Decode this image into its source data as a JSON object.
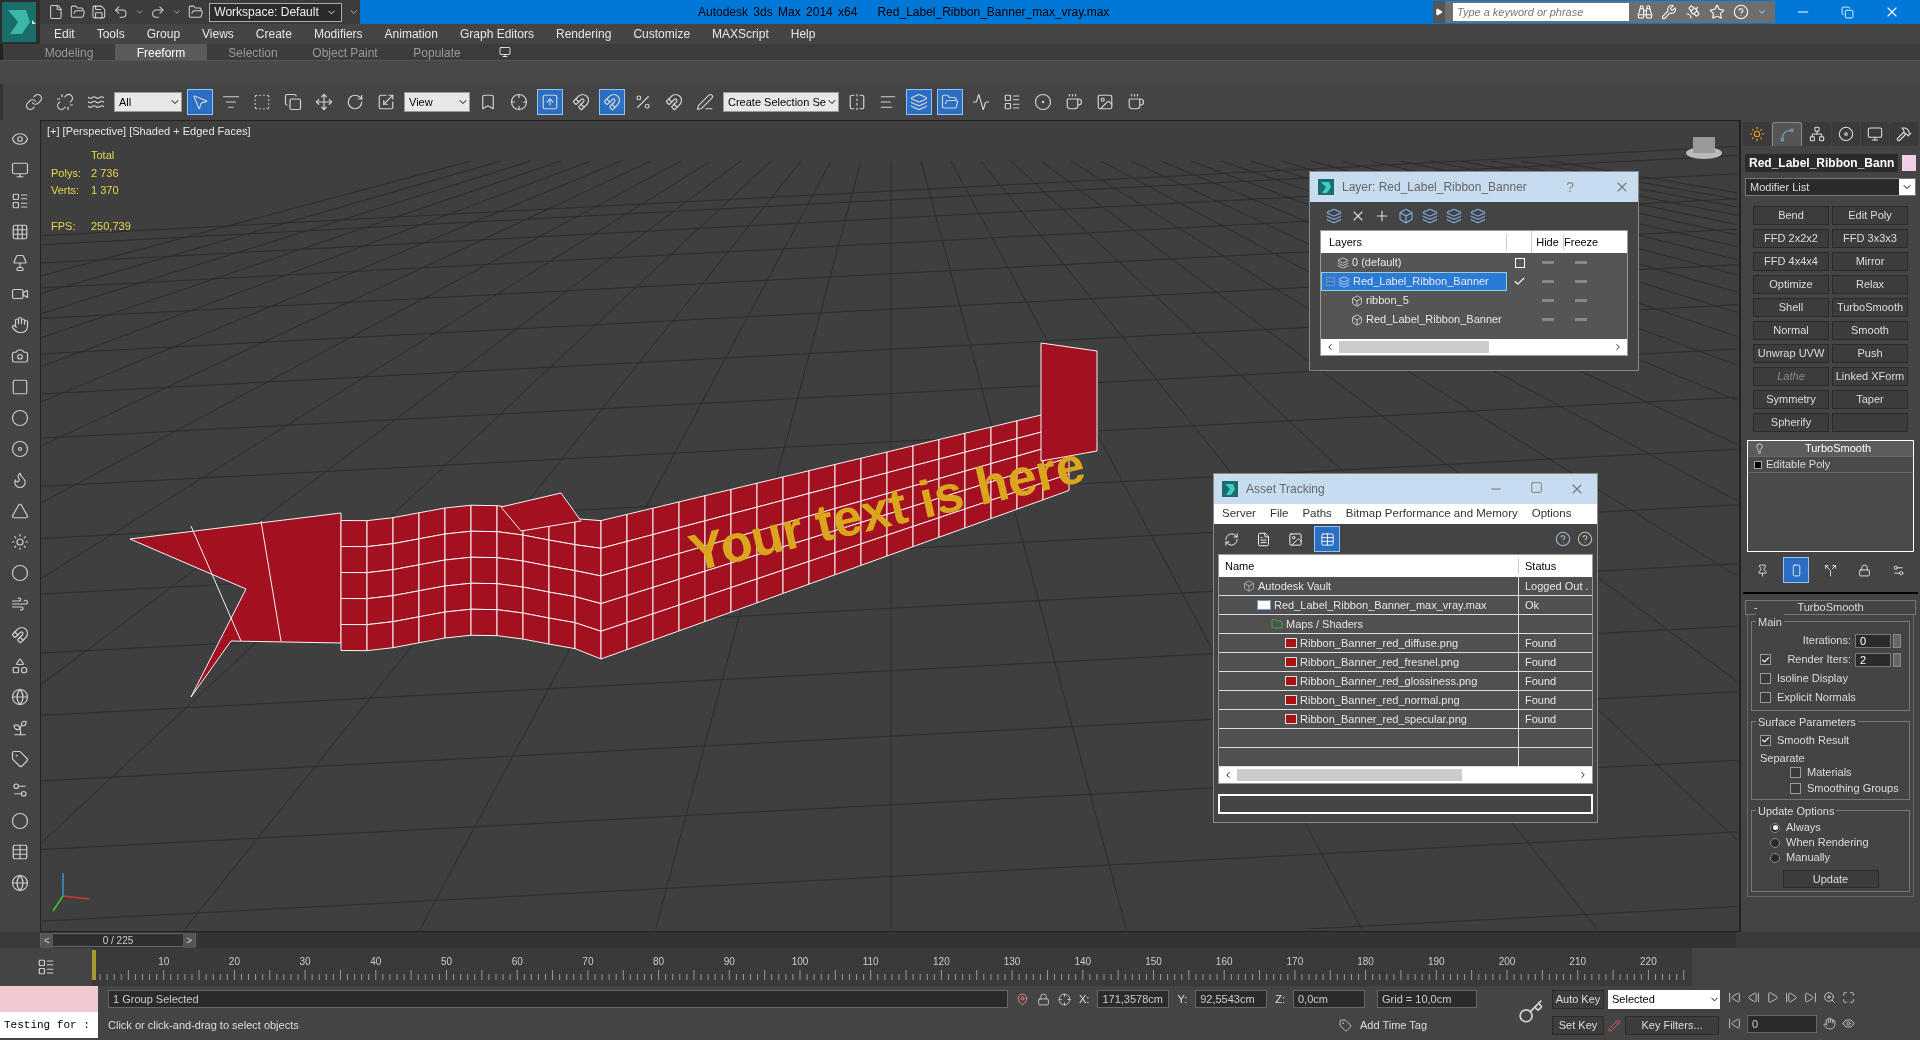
{
  "title_bar": {
    "workspace": "Workspace: Default",
    "app_title": "Autodesk 3ds Max  2014 x64",
    "file_name": "Red_Label_Ribbon_Banner_max_vray.max",
    "search_placeholder": "Type a keyword or phrase"
  },
  "menu_bar": [
    "Edit",
    "Tools",
    "Group",
    "Views",
    "Create",
    "Modifiers",
    "Animation",
    "Graph Editors",
    "Rendering",
    "Customize",
    "MAXScript",
    "Help"
  ],
  "ribbon_tabs": [
    {
      "label": "Modeling",
      "selected": false
    },
    {
      "label": "Freeform",
      "selected": true
    },
    {
      "label": "Selection",
      "selected": false
    },
    {
      "label": "Object Paint",
      "selected": false
    },
    {
      "label": "Populate",
      "selected": false
    }
  ],
  "main_toolbar": [
    {
      "kind": "icon",
      "pressed": false
    },
    {
      "kind": "icon",
      "pressed": false
    },
    {
      "kind": "icon",
      "pressed": false
    },
    {
      "kind": "dropdown",
      "value": "All"
    },
    {
      "kind": "icon",
      "pressed": true
    },
    {
      "kind": "icon",
      "pressed": false
    },
    {
      "kind": "icon",
      "pressed": false
    },
    {
      "kind": "icon",
      "pressed": false
    },
    {
      "kind": "icon",
      "pressed": false
    },
    {
      "kind": "icon",
      "pressed": false
    },
    {
      "kind": "icon",
      "pressed": false
    },
    {
      "kind": "dropdown",
      "value": "View"
    },
    {
      "kind": "icon",
      "pressed": false
    },
    {
      "kind": "icon",
      "pressed": false
    },
    {
      "kind": "icon",
      "pressed": true
    },
    {
      "kind": "icon",
      "pressed": false
    },
    {
      "kind": "icon",
      "pressed": true
    },
    {
      "kind": "icon",
      "pressed": false
    },
    {
      "kind": "icon",
      "pressed": false
    },
    {
      "kind": "icon",
      "pressed": false
    },
    {
      "kind": "dropdown",
      "value": "Create Selection Se"
    },
    {
      "kind": "icon",
      "pressed": false
    },
    {
      "kind": "icon",
      "pressed": false
    },
    {
      "kind": "icon",
      "pressed": true
    },
    {
      "kind": "icon",
      "pressed": true
    },
    {
      "kind": "icon",
      "pressed": false
    },
    {
      "kind": "icon",
      "pressed": false
    },
    {
      "kind": "icon",
      "pressed": false
    },
    {
      "kind": "icon",
      "pressed": false
    },
    {
      "kind": "icon",
      "pressed": false
    },
    {
      "kind": "icon",
      "pressed": false
    }
  ],
  "viewport": {
    "label": "[+] [Perspective] [Shaded + Edged Faces]",
    "stats_heading": "Total",
    "stats": [
      {
        "label": "Polys:",
        "value": "2 736"
      },
      {
        "label": "Verts:",
        "value": "1 370"
      }
    ],
    "fps_label": "FPS:",
    "fps_value": "250,739",
    "banner_text": "Your text is here"
  },
  "layer_dialog": {
    "title": "Layer: Red_Label_Ribbon_Banner",
    "help": "?",
    "columns": [
      "Layers",
      "Hide",
      "Freeze"
    ],
    "rows": [
      {
        "kind": "layer",
        "name": "0 (default)",
        "selected": false,
        "current": false
      },
      {
        "kind": "layer",
        "name": "Red_Label_Ribbon_Banner",
        "selected": true,
        "current": true,
        "expanded": true,
        "children": [
          {
            "kind": "object",
            "name": "ribbon_5",
            "selected": false
          },
          {
            "kind": "object",
            "name": "Red_Label_Ribbon_Banner",
            "selected": false
          }
        ]
      }
    ]
  },
  "asset_tracking": {
    "title": "Asset Tracking",
    "menu": [
      "Server",
      "File",
      "Paths",
      "Bitmap Performance and Memory",
      "Options"
    ],
    "toolbar": [
      {
        "pressed": false
      },
      {
        "pressed": false
      },
      {
        "pressed": false
      },
      {
        "pressed": true
      }
    ],
    "columns": [
      "Name",
      "Status"
    ],
    "rows": [
      {
        "kind": "vault",
        "name": "Autodesk Vault",
        "status": "Logged Out .",
        "children": [
          {
            "kind": "file",
            "name": "Red_Label_Ribbon_Banner_max_vray.max",
            "status": "Ok",
            "children": [
              {
                "kind": "folder",
                "name": "Maps / Shaders",
                "children": [
                  {
                    "kind": "png",
                    "name": "Ribbon_Banner_red_diffuse.png",
                    "status": "Found"
                  },
                  {
                    "kind": "png",
                    "name": "Ribbon_Banner_red_fresnel.png",
                    "status": "Found"
                  },
                  {
                    "kind": "png",
                    "name": "Ribbon_Banner_red_glossiness.png",
                    "status": "Found"
                  },
                  {
                    "kind": "png",
                    "name": "Ribbon_Banner_red_normal.png",
                    "status": "Found"
                  },
                  {
                    "kind": "png",
                    "name": "Ribbon_Banner_red_specular.png",
                    "status": "Found"
                  }
                ]
              }
            ]
          }
        ]
      }
    ]
  },
  "command_panel": {
    "tabs": [
      {
        "selected": false
      },
      {
        "selected": true
      },
      {
        "selected": false
      },
      {
        "selected": false
      },
      {
        "selected": false
      },
      {
        "selected": false
      }
    ],
    "object": {
      "name": "Red_Label_Ribbon_Bann",
      "color": "#f2cfe6"
    },
    "modifier_list": "Modifier List",
    "modifier_buttons": [
      {
        "label": "Bend",
        "disabled": false
      },
      {
        "label": "Edit Poly",
        "disabled": false
      },
      {
        "label": "FFD 2x2x2",
        "disabled": false
      },
      {
        "label": "FFD 3x3x3",
        "disabled": false
      },
      {
        "label": "FFD 4x4x4",
        "disabled": false
      },
      {
        "label": "Mirror",
        "disabled": false
      },
      {
        "label": "Optimize",
        "disabled": false
      },
      {
        "label": "Relax",
        "disabled": false
      },
      {
        "label": "Shell",
        "disabled": false
      },
      {
        "label": "TurboSmooth",
        "disabled": false
      },
      {
        "label": "Normal",
        "disabled": false
      },
      {
        "label": "Smooth",
        "disabled": false
      },
      {
        "label": "Unwrap UVW",
        "disabled": false
      },
      {
        "label": "Push",
        "disabled": false
      },
      {
        "label": "Lathe",
        "disabled": true
      },
      {
        "label": "Linked XForm",
        "disabled": false
      },
      {
        "label": "Symmetry",
        "disabled": false
      },
      {
        "label": "Taper",
        "disabled": false
      },
      {
        "label": "Spherify",
        "disabled": false
      }
    ],
    "stack": [
      {
        "kind": "modifier",
        "name": "TurboSmooth",
        "selected": true
      },
      {
        "kind": "base",
        "name": "Editable Poly",
        "selected": false
      }
    ],
    "stack_toolbar": [
      {
        "pressed": false
      },
      {
        "pressed": true
      },
      {
        "pressed": false
      },
      {
        "pressed": false
      },
      {
        "pressed": false
      }
    ],
    "rollout": {
      "toggle": "-",
      "title": "TurboSmooth",
      "groups": [
        {
          "title": "Main",
          "controls": [
            {
              "kind": "spinner",
              "label": "Iterations:",
              "value": "0"
            },
            {
              "kind": "check_spinner",
              "label": "Render Iters:",
              "checked": true,
              "value": "2"
            },
            {
              "kind": "checkbox",
              "label": "Isoline Display",
              "checked": false
            },
            {
              "kind": "checkbox",
              "label": "Explicit Normals",
              "checked": false
            }
          ]
        },
        {
          "title": "Surface Parameters",
          "controls": [
            {
              "kind": "checkbox",
              "label": "Smooth Result",
              "checked": true
            },
            {
              "kind": "text",
              "label": "Separate"
            },
            {
              "kind": "sub_checkbox",
              "label": "Materials",
              "checked": false
            },
            {
              "kind": "sub_checkbox",
              "label": "Smoothing Groups",
              "checked": false
            }
          ]
        },
        {
          "title": "Update Options",
          "controls": [
            {
              "kind": "radio",
              "label": "Always",
              "selected": true
            },
            {
              "kind": "radio",
              "label": "When Rendering",
              "selected": false
            },
            {
              "kind": "radio",
              "label": "Manually",
              "selected": false
            },
            {
              "kind": "button",
              "label": "Update"
            }
          ]
        }
      ]
    }
  },
  "timeline": {
    "frame": "0 / 225",
    "level": 0,
    "prev": "<",
    "next": ">",
    "labels": [
      "10",
      "20",
      "30",
      "40",
      "50",
      "60",
      "70",
      "80",
      "90",
      "100",
      "110",
      "120",
      "130",
      "140",
      "150",
      "160",
      "170",
      "180",
      "190",
      "200",
      "210",
      "220"
    ]
  },
  "status_bar": {
    "listener": "Testing for :",
    "selection": "1 Group Selected",
    "prompt": "Click or click-and-drag to select objects",
    "coords": [
      {
        "axis": "X:",
        "value": "171,3578cm"
      },
      {
        "axis": "Y:",
        "value": "92,5543cm"
      },
      {
        "axis": "Z:",
        "value": "0,0cm"
      }
    ],
    "grid": "Grid = 10,0cm",
    "add_time_tag": "Add Time Tag",
    "auto_key": "Auto Key",
    "key_mode": "Selected",
    "set_key": "Set Key",
    "key_filters": "Key Filters...",
    "frame": "0"
  }
}
